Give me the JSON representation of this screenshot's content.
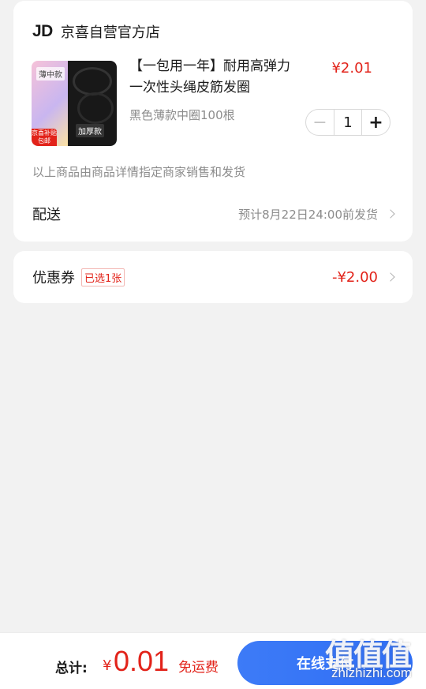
{
  "store": {
    "logo": "JD",
    "name": "京喜自营官方店"
  },
  "product": {
    "title": "【一包用一年】耐用高弹力一次性头绳皮筋发圈",
    "price": "¥2.01",
    "spec": "黑色薄款中圈100根",
    "quantity": "1",
    "image": {
      "tag_thin": "薄中款",
      "tag_thick": "加厚款",
      "badge": "京喜补贴 包邮"
    }
  },
  "seller_note": "以上商品由商品详情指定商家销售和发货",
  "delivery": {
    "label": "配送",
    "value": "预计8月22日24:00前发货"
  },
  "coupon": {
    "label": "优惠券",
    "tag": "已选1张",
    "value": "-¥2.00"
  },
  "footer": {
    "total_label": "总计:",
    "currency": "¥",
    "total_amount": "0.01",
    "free_shipping": "免运费",
    "pay_button": "在线支付"
  },
  "watermark": {
    "glyphs": "值值值",
    "url": "zhizhizhi.com"
  },
  "colors": {
    "accent_red": "#e2231a",
    "pay_blue": "#2f6ef5",
    "background": "#f2f2f2"
  },
  "icons": [
    "chevron-right-icon",
    "minus-icon",
    "plus-icon"
  ]
}
